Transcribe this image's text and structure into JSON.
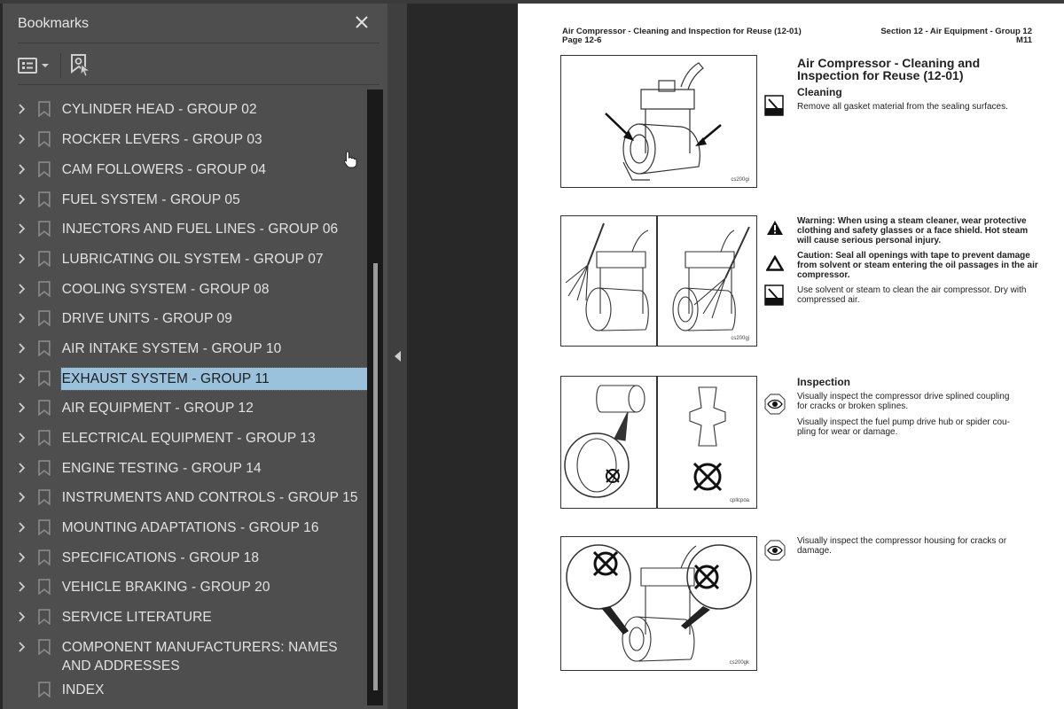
{
  "sidebar": {
    "title": "Bookmarks",
    "close_icon": "close-icon",
    "toolbar": {
      "options_icon": "list-options-icon",
      "find_bookmark_icon": "find-current-bookmark-icon"
    },
    "items": [
      {
        "label": "CYLINDER HEAD - GROUP 02",
        "expandable": true
      },
      {
        "label": "ROCKER LEVERS - GROUP 03",
        "expandable": true
      },
      {
        "label": "CAM FOLLOWERS - GROUP 04",
        "expandable": true
      },
      {
        "label": "FUEL SYSTEM - GROUP 05",
        "expandable": true
      },
      {
        "label": "INJECTORS AND FUEL LINES - GROUP 06",
        "expandable": true
      },
      {
        "label": "LUBRICATING OIL SYSTEM - GROUP 07",
        "expandable": true
      },
      {
        "label": "COOLING SYSTEM - GROUP 08",
        "expandable": true
      },
      {
        "label": "DRIVE UNITS - GROUP 09",
        "expandable": true
      },
      {
        "label": "AIR INTAKE SYSTEM - GROUP 10",
        "expandable": true
      },
      {
        "label": "EXHAUST SYSTEM - GROUP 11",
        "expandable": true,
        "selected": true
      },
      {
        "label": "AIR EQUIPMENT - GROUP 12",
        "expandable": true
      },
      {
        "label": "ELECTRICAL EQUIPMENT - GROUP 13",
        "expandable": true
      },
      {
        "label": "ENGINE TESTING - GROUP 14",
        "expandable": true
      },
      {
        "label": "INSTRUMENTS AND CONTROLS - GROUP 15",
        "expandable": true
      },
      {
        "label": "MOUNTING ADAPTATIONS - GROUP 16",
        "expandable": true
      },
      {
        "label": "SPECIFICATIONS - GROUP 18",
        "expandable": true
      },
      {
        "label": "VEHICLE BRAKING - GROUP 20",
        "expandable": true
      },
      {
        "label": "SERVICE LITERATURE",
        "expandable": true
      },
      {
        "label": "COMPONENT MANUFACTURERS:  NAMES AND ADDRESSES",
        "expandable": true
      },
      {
        "label": "INDEX",
        "expandable": false
      }
    ],
    "selected_color": "#9ac2dd"
  },
  "page": {
    "header_left_line1": "Air Compressor - Cleaning and Inspection for Reuse (12-01)",
    "header_left_line2": "Page 12-6",
    "header_right_line1": "Section 12 - Air Equipment - Group 12",
    "header_right_line2": "M11",
    "title_line1": "Air Compressor - Cleaning and",
    "title_line2": "Inspection for Reuse (12-01)",
    "cleaning_heading": "Cleaning",
    "cleaning_step1": "Remove all gasket material from the sealing surfaces.",
    "warning_text_1": "Warning:  When using a steam cleaner, wear protective",
    "warning_text_2": "clothing and safety glasses or a face shield. Hot steam",
    "warning_text_3": "will cause serious personal injury.",
    "caution_text_1": "Caution:  Seal all openings with tape to prevent damage",
    "caution_text_2": "from solvent or steam entering the oil passages in the air",
    "caution_text_3": "compressor.",
    "clean_step_1": "Use solvent or steam to clean the air compressor. Dry with",
    "clean_step_2": "compressed air.",
    "inspection_heading": "Inspection",
    "inspect1_1": "Visually inspect the compressor drive splined coupling",
    "inspect1_2": "for cracks or broken splines.",
    "inspect2_1": "Visually inspect the fuel pump drive hub or spider cou-",
    "inspect2_2": "pling for wear or damage.",
    "inspect3_1": "Visually inspect the compressor housing for cracks or",
    "inspect3_2": "damage.",
    "figures": [
      {
        "caption": "cs200gi",
        "icon": "compressor-illustration"
      },
      {
        "caption": "cs200gj",
        "icon": "steam-cleaning-illustration"
      },
      {
        "caption": "cpllcpoa",
        "icon": "coupling-illustration"
      },
      {
        "caption": "cs200gk",
        "icon": "compressor-housing-illustration"
      }
    ]
  }
}
